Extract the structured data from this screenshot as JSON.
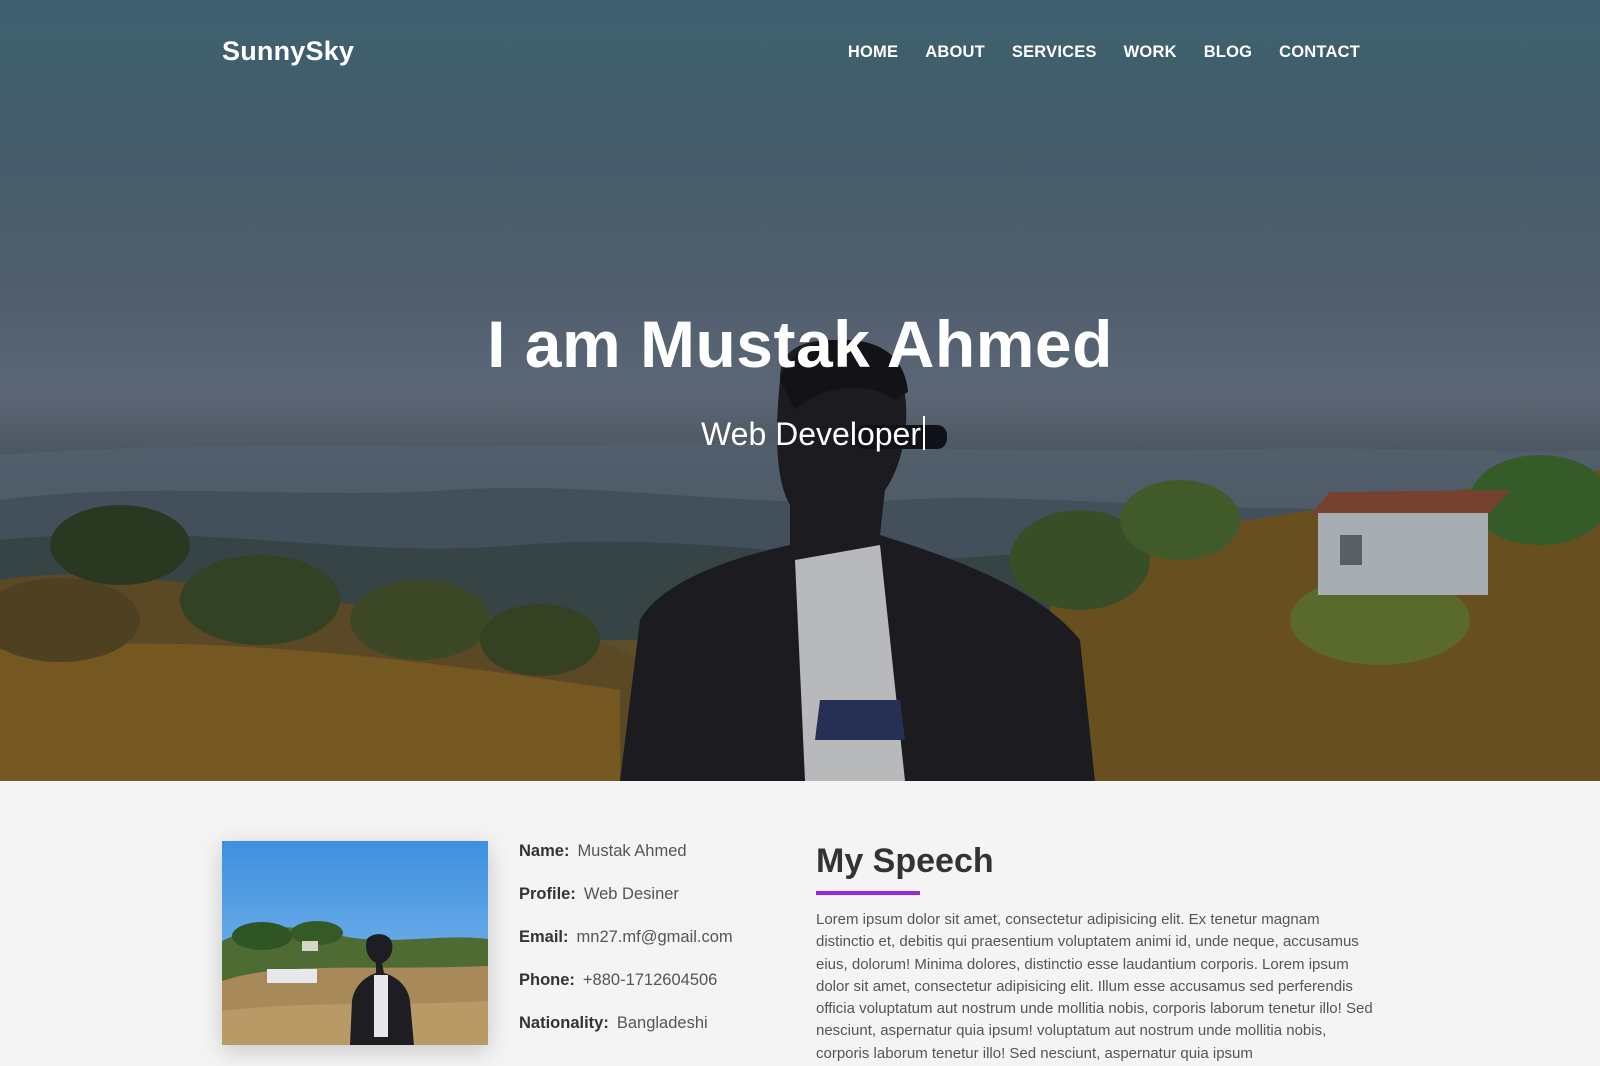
{
  "brand": {
    "logo_text": "SunnySky"
  },
  "nav": {
    "items": [
      {
        "label": "HOME"
      },
      {
        "label": "ABOUT"
      },
      {
        "label": "SERVICES"
      },
      {
        "label": "WORK"
      },
      {
        "label": "BLOG"
      },
      {
        "label": "CONTACT"
      }
    ]
  },
  "hero": {
    "title": "I am Mustak Ahmed",
    "subtitle": "Web Developer"
  },
  "about": {
    "info": [
      {
        "key": "Name:",
        "value": "Mustak Ahmed"
      },
      {
        "key": "Profile:",
        "value": "Web Desiner"
      },
      {
        "key": "Email:",
        "value": "mn27.mf@gmail.com"
      },
      {
        "key": "Phone:",
        "value": "+880-1712604506"
      },
      {
        "key": "Nationality:",
        "value": "Bangladeshi"
      }
    ],
    "speech_title": "My Speech",
    "speech_text": "Lorem ipsum dolor sit amet, consectetur adipisicing elit. Ex tenetur magnam distinctio et, debitis qui praesentium voluptatem animi id, unde neque, accusamus eius, dolorum! Minima dolores, distinctio esse laudantium corporis. Lorem ipsum dolor sit amet, consectetur adipisicing elit. Illum esse accusamus sed perferendis officia voluptatum aut nostrum unde mollitia nobis, corporis laborum tenetur illo! Sed nesciunt, aspernatur quia ipsum! voluptatum aut nostrum unde mollitia nobis, corporis laborum tenetur illo! Sed nesciunt, aspernatur quia ipsum"
  },
  "colors": {
    "accent": "#9c27d6",
    "background": "#f4f4f4",
    "nav_text": "#ffffff"
  }
}
